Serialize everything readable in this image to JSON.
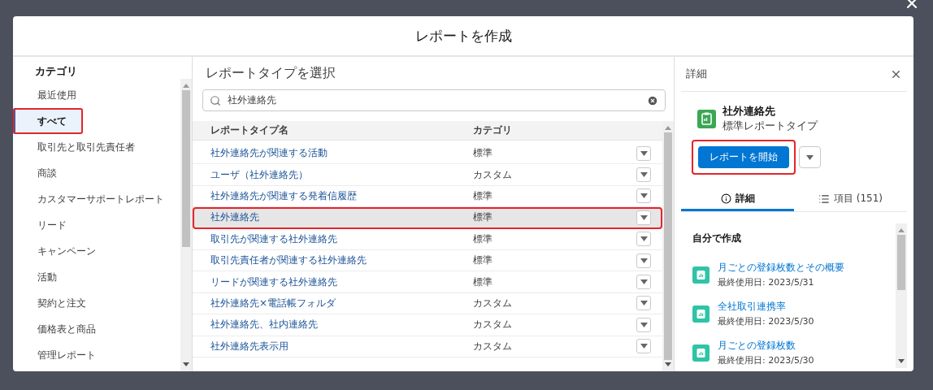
{
  "dialog": {
    "title": "レポートを作成"
  },
  "categories": {
    "title": "カテゴリ",
    "items": [
      {
        "label": "最近使用",
        "selected": false,
        "highlighted": false
      },
      {
        "label": "すべて",
        "selected": true,
        "highlighted": true
      },
      {
        "label": "取引先と取引先責任者",
        "selected": false,
        "highlighted": false
      },
      {
        "label": "商談",
        "selected": false,
        "highlighted": false
      },
      {
        "label": "カスタマーサポートレポート",
        "selected": false,
        "highlighted": false
      },
      {
        "label": "リード",
        "selected": false,
        "highlighted": false
      },
      {
        "label": "キャンペーン",
        "selected": false,
        "highlighted": false
      },
      {
        "label": "活動",
        "selected": false,
        "highlighted": false
      },
      {
        "label": "契約と注文",
        "selected": false,
        "highlighted": false
      },
      {
        "label": "価格表と商品",
        "selected": false,
        "highlighted": false
      },
      {
        "label": "管理レポート",
        "selected": false,
        "highlighted": false
      }
    ]
  },
  "report_types": {
    "title": "レポートタイプを選択",
    "search": {
      "value": "社外連絡先"
    },
    "columns": [
      "レポートタイプ名",
      "カテゴリ"
    ],
    "rows": [
      {
        "name": "社外連絡先が関連する活動",
        "category": "標準",
        "selected": false,
        "highlighted": false
      },
      {
        "name": "ユーザ（社外連絡先）",
        "category": "カスタム",
        "selected": false,
        "highlighted": false
      },
      {
        "name": "社外連絡先が関連する発着信履歴",
        "category": "標準",
        "selected": false,
        "highlighted": false
      },
      {
        "name": "社外連絡先",
        "category": "標準",
        "selected": true,
        "highlighted": true
      },
      {
        "name": "取引先が関連する社外連絡先",
        "category": "標準",
        "selected": false,
        "highlighted": false
      },
      {
        "name": "取引先責任者が関連する社外連絡先",
        "category": "標準",
        "selected": false,
        "highlighted": false
      },
      {
        "name": "リードが関連する社外連絡先",
        "category": "標準",
        "selected": false,
        "highlighted": false
      },
      {
        "name": "社外連絡先×電話帳フォルダ",
        "category": "カスタム",
        "selected": false,
        "highlighted": false
      },
      {
        "name": "社外連絡先、社内連絡先",
        "category": "カスタム",
        "selected": false,
        "highlighted": false
      },
      {
        "name": "社外連絡先表示用",
        "category": "カスタム",
        "selected": false,
        "highlighted": false
      }
    ]
  },
  "details": {
    "title": "詳細",
    "type_name": "社外連絡先",
    "type_kind": "標準レポートタイプ",
    "start_button": {
      "label": "レポートを開始",
      "highlighted": true
    },
    "tabs": [
      {
        "label": "詳細",
        "kind": "info",
        "selected": true
      },
      {
        "label": "項目 (151)",
        "kind": "list",
        "selected": false
      }
    ],
    "section_title": "自分で作成",
    "reports": [
      {
        "name": "月ごとの登録枚数とその概要",
        "last_used": "最終使用日: 2023/5/31"
      },
      {
        "name": "全社取引連携率",
        "last_used": "最終使用日: 2023/5/30"
      },
      {
        "name": "月ごとの登録枚数",
        "last_used": "最終使用日: 2023/5/30"
      }
    ]
  }
}
